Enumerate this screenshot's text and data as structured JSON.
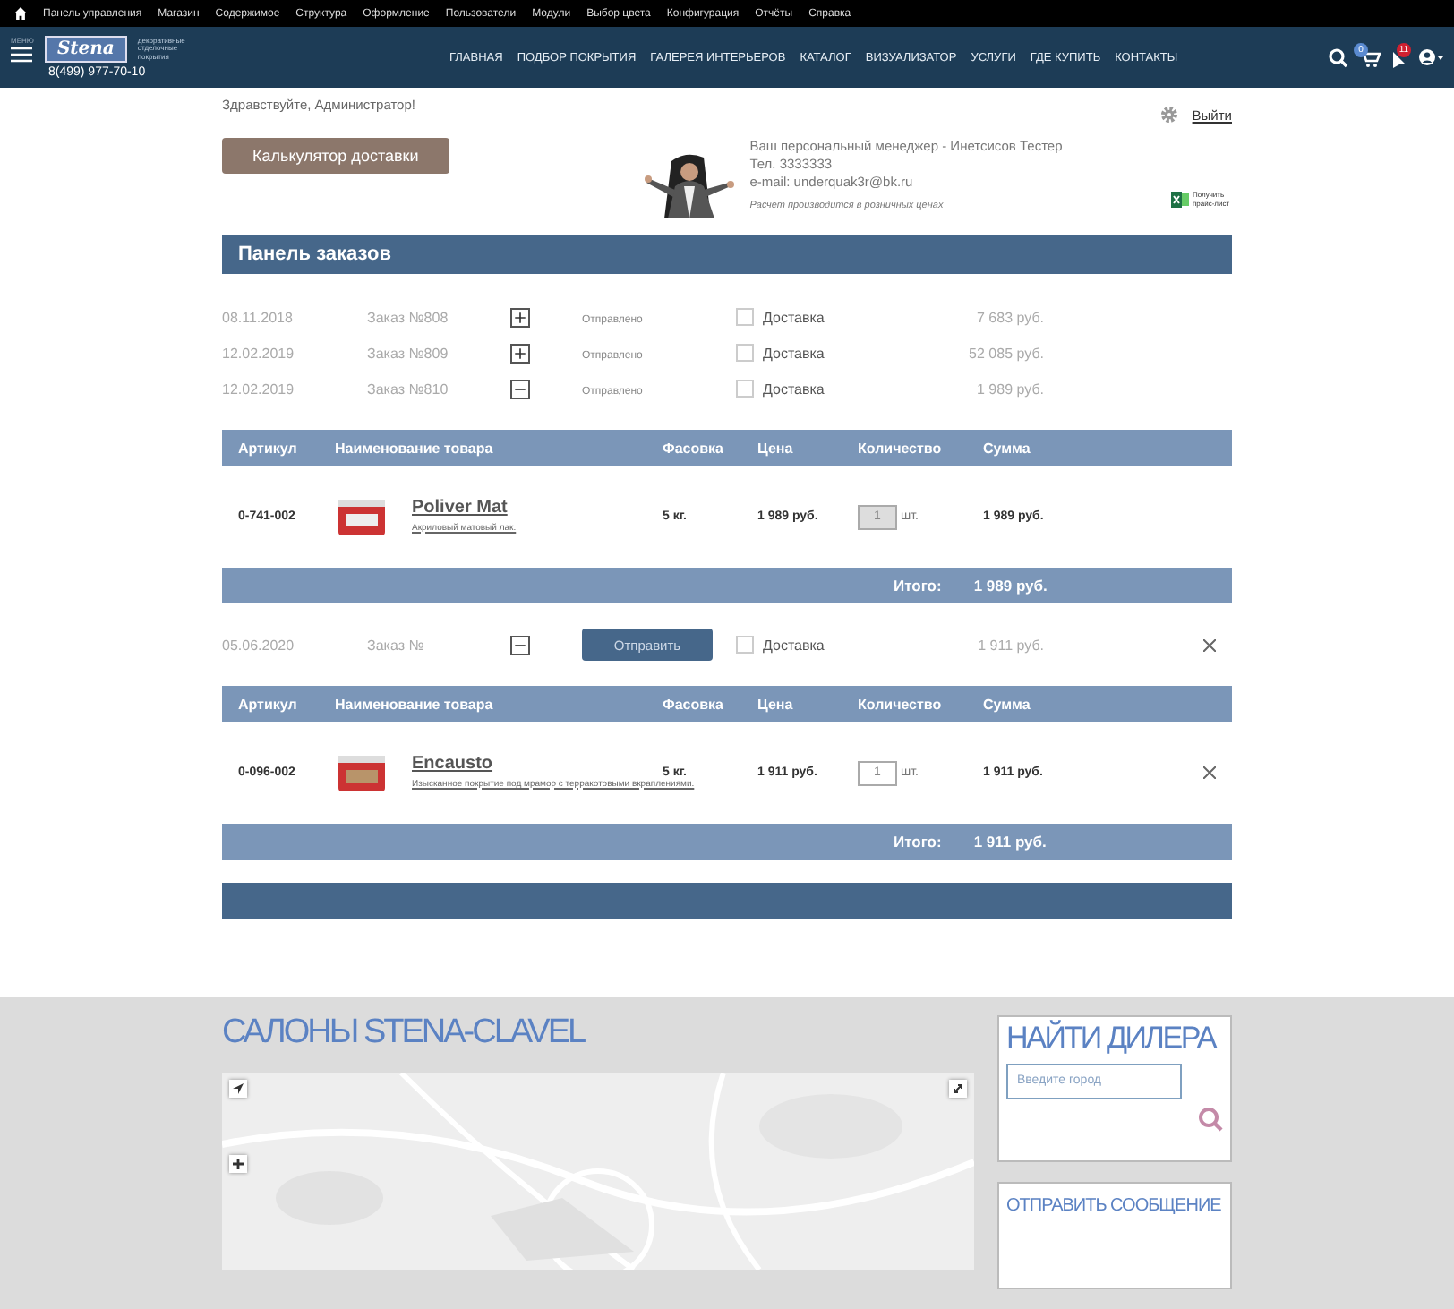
{
  "admin_bar": {
    "items": [
      "Панель управления",
      "Магазин",
      "Содержимое",
      "Структура",
      "Оформление",
      "Пользователи",
      "Модули",
      "Выбор цвета",
      "Конфигурация",
      "Отчёты",
      "Справка"
    ]
  },
  "header": {
    "menu_label": "МЕНЮ",
    "logo": "Stena",
    "logo_tagline": "декоративные отделочные покрытия",
    "phone": "8(499) 977-70-10",
    "nav": [
      "ГЛАВНАЯ",
      "ПОДБОР ПОКРЫТИЯ",
      "ГАЛЕРЕЯ ИНТЕРЬЕРОВ",
      "КАТАЛОГ",
      "ВИЗУАЛИЗАТОР",
      "УСЛУГИ",
      "ГДЕ КУПИТЬ",
      "КОНТАКТЫ"
    ],
    "cart_count": "0",
    "notification_count": "11"
  },
  "greeting": "Здравствуйте, Администратор!",
  "logout": "Выйти",
  "calculator_button": "Калькулятор доставки",
  "manager": {
    "lines": [
      "Ваш персональный менеджер - Инетсисов Тестер",
      "Тел. 3333333",
      "e-mail: underquak3r@bk.ru"
    ],
    "note": "Расчет производится в розничных ценах",
    "pricelist": "Получить прайс-лист"
  },
  "panel_title": "Панель заказов",
  "orders": [
    {
      "kind": "sent",
      "date": "08.11.2018",
      "number": "Заказ №808",
      "expanded": false,
      "status": "Отправлено",
      "delivery": "Доставка",
      "delivery_checked": false,
      "total": "7 683 руб."
    },
    {
      "kind": "sent",
      "date": "12.02.2019",
      "number": "Заказ №809",
      "expanded": false,
      "status": "Отправлено",
      "delivery": "Доставка",
      "delivery_checked": false,
      "total": "52 085 руб."
    },
    {
      "kind": "sent",
      "date": "12.02.2019",
      "number": "Заказ №810",
      "expanded": true,
      "status": "Отправлено",
      "delivery": "Доставка",
      "delivery_checked": false,
      "total": "1 989 руб.",
      "columns": [
        "Артикул",
        "Наименование товара",
        "Фасовка",
        "Цена",
        "Количество",
        "Сумма"
      ],
      "items": [
        {
          "article": "0-741-002",
          "name": "Poliver Mat",
          "description": "Акриловый матовый лак.",
          "pack": "5 кг.",
          "price": "1 989 руб.",
          "quantity": "1",
          "unit": "шт.",
          "sum": "1 989 руб.",
          "disabled": true
        }
      ],
      "total_label": "Итого:",
      "total_value": "1 989 руб."
    },
    {
      "kind": "draft",
      "date": "05.06.2020",
      "number": "Заказ №",
      "expanded": true,
      "send_button": "Отправить",
      "delivery": "Доставка",
      "delivery_checked": false,
      "total": "1 911 руб.",
      "columns": [
        "Артикул",
        "Наименование товара",
        "Фасовка",
        "Цена",
        "Количество",
        "Сумма"
      ],
      "items": [
        {
          "article": "0-096-002",
          "name": "Encausto",
          "description": "Изысканное покрытие под мрамор с терракотовыми вкраплениями.",
          "pack": "5 кг.",
          "price": "1 911 руб.",
          "quantity": "1",
          "unit": "шт.",
          "sum": "1 911 руб.",
          "disabled": false
        }
      ],
      "total_label": "Итого:",
      "total_value": "1 911 руб."
    }
  ],
  "salons": {
    "title": "САЛОНЫ STENA-CLAVEL"
  },
  "dealer": {
    "title": "НАЙТИ ДИЛЕРА",
    "placeholder": "Введите город"
  },
  "message": {
    "title": "ОТПРАВИТЬ СООБЩЕНИЕ"
  }
}
